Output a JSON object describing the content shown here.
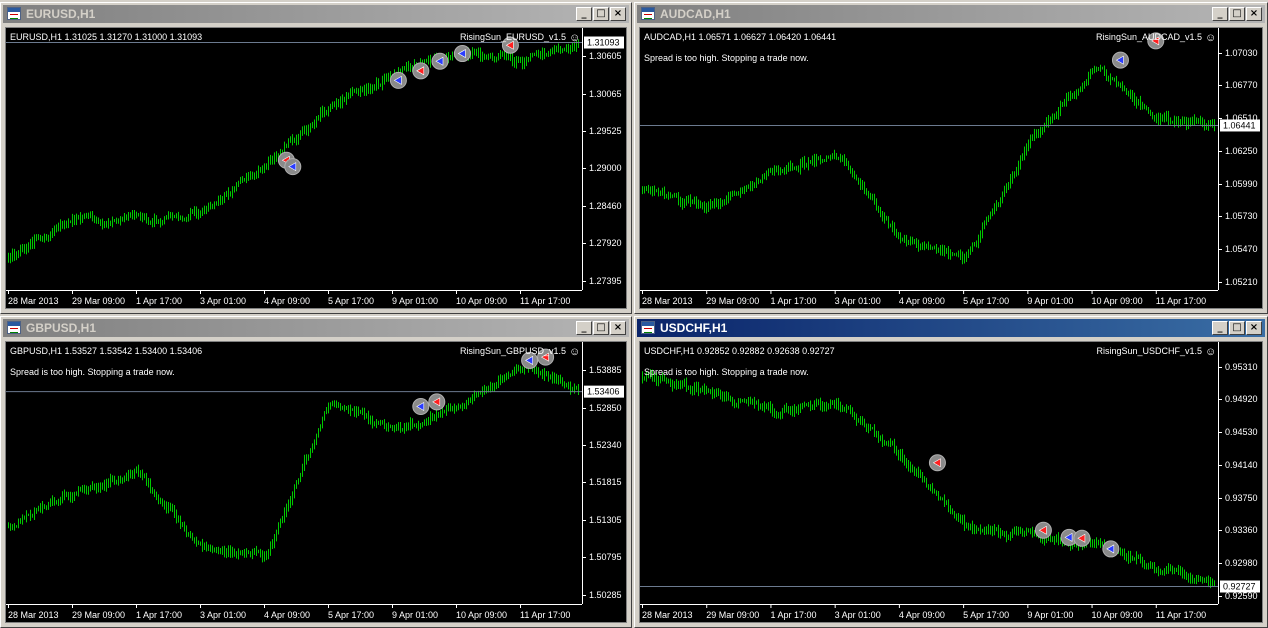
{
  "timeLabels": [
    "28 Mar 2013",
    "29 Mar 09:00",
    "1 Apr 17:00",
    "3 Apr 01:00",
    "4 Apr 09:00",
    "5 Apr 17:00",
    "9 Apr 01:00",
    "10 Apr 09:00",
    "11 Apr 17:00"
  ],
  "windowButtons": {
    "minimize": "_",
    "maximize": "□",
    "close": "×"
  },
  "colors": {
    "candle": "#00c800",
    "priceLine": "#6b7a8f",
    "axis": "#ffffff",
    "buyArrow": "#2a3cff",
    "sellArrow": "#ff2020",
    "circle": "#8a8a8a"
  },
  "windows": [
    {
      "id": "eurusd",
      "title": "EURUSD,H1",
      "active": false,
      "infoLine": "EURUSD,H1  1.31025 1.31270 1.31000 1.31093",
      "expert": "RisingSun_EURUSD_v1.5",
      "message": "",
      "currentPrice": "1.31093",
      "priceTicks": [
        "1.30605",
        "1.30065",
        "1.29525",
        "1.29000",
        "1.28460",
        "1.27920",
        "1.27395"
      ]
    },
    {
      "id": "audcad",
      "title": "AUDCAD,H1",
      "active": false,
      "infoLine": "AUDCAD,H1  1.06571 1.06627 1.06420 1.06441",
      "expert": "RisingSun_AUDCAD_v1.5",
      "message": "Spread is too high. Stopping a trade now.",
      "currentPrice": "1.06441",
      "priceTicks": [
        "1.07030",
        "1.06770",
        "1.06510",
        "1.06250",
        "1.05990",
        "1.05730",
        "1.05470",
        "1.05210"
      ]
    },
    {
      "id": "gbpusd",
      "title": "GBPUSD,H1",
      "active": false,
      "infoLine": "GBPUSD,H1  1.53527 1.53542 1.53400 1.53406",
      "expert": "RisingSun_GBPUSD_v1.5",
      "message": "Spread is too high. Stopping a trade now.",
      "currentPrice": "1.53406",
      "priceTicks": [
        "1.53885",
        "1.52850",
        "1.52340",
        "1.51815",
        "1.51305",
        "1.50795",
        "1.50285"
      ]
    },
    {
      "id": "usdchf",
      "title": "USDCHF,H1",
      "active": true,
      "infoLine": "USDCHF,H1  0.92852 0.92882 0.92638 0.92727",
      "expert": "RisingSun_USDCHF_v1.5",
      "message": "Spread is too high. Stopping a trade now.",
      "currentPrice": "0.92727",
      "priceTicks": [
        "0.95310",
        "0.94920",
        "0.94530",
        "0.94140",
        "0.93750",
        "0.93360",
        "0.92980",
        "0.92590"
      ]
    }
  ],
  "chart_data": [
    {
      "type": "line",
      "symbol": "EURUSD",
      "ylim": [
        1.2722,
        1.3132
      ],
      "x": [
        "28 Mar 2013",
        "29 Mar 09:00",
        "1 Apr 17:00",
        "3 Apr 01:00",
        "4 Apr 09:00",
        "5 Apr 17:00",
        "9 Apr 01:00",
        "10 Apr 09:00",
        "11 Apr 17:00"
      ],
      "values": [
        1.2775,
        1.2835,
        1.283,
        1.2845,
        1.292,
        1.301,
        1.306,
        1.3095,
        1.308
      ],
      "last": 1.31093,
      "trades": [
        {
          "x": 4.35,
          "price": 1.2925,
          "dir": "sell"
        },
        {
          "x": 4.45,
          "price": 1.2915,
          "dir": "buy"
        },
        {
          "x": 6.1,
          "price": 1.305,
          "dir": "buy"
        },
        {
          "x": 6.45,
          "price": 1.3065,
          "dir": "sell"
        },
        {
          "x": 6.75,
          "price": 1.308,
          "dir": "buy"
        },
        {
          "x": 7.1,
          "price": 1.3092,
          "dir": "buy"
        },
        {
          "x": 7.85,
          "price": 1.3105,
          "dir": "sell"
        }
      ]
    },
    {
      "type": "line",
      "symbol": "AUDCAD",
      "ylim": [
        1.0516,
        1.072
      ],
      "x": [
        "28 Mar 2013",
        "29 Mar 09:00",
        "1 Apr 17:00",
        "3 Apr 01:00",
        "4 Apr 09:00",
        "5 Apr 17:00",
        "9 Apr 01:00",
        "10 Apr 09:00",
        "11 Apr 17:00"
      ],
      "values": [
        1.0595,
        1.058,
        1.061,
        1.062,
        1.0555,
        1.054,
        1.063,
        1.069,
        1.065
      ],
      "last": 1.06441,
      "trades": [
        {
          "x": 7.45,
          "price": 1.0695,
          "dir": "buy"
        },
        {
          "x": 8.0,
          "price": 1.071,
          "dir": "sell"
        }
      ]
    },
    {
      "type": "line",
      "symbol": "GBPUSD",
      "ylim": [
        1.5018,
        1.5416
      ],
      "x": [
        "28 Mar 2013",
        "29 Mar 09:00",
        "1 Apr 17:00",
        "3 Apr 01:00",
        "4 Apr 09:00",
        "5 Apr 17:00",
        "9 Apr 01:00",
        "10 Apr 09:00",
        "11 Apr 17:00"
      ],
      "values": [
        1.514,
        1.5185,
        1.522,
        1.51,
        1.509,
        1.533,
        1.528,
        1.532,
        1.538
      ],
      "last": 1.53406,
      "trades": [
        {
          "x": 6.45,
          "price": 1.5318,
          "dir": "buy"
        },
        {
          "x": 6.7,
          "price": 1.5325,
          "dir": "sell"
        },
        {
          "x": 8.15,
          "price": 1.5388,
          "dir": "buy"
        },
        {
          "x": 8.4,
          "price": 1.5393,
          "dir": "sell"
        }
      ]
    },
    {
      "type": "line",
      "symbol": "USDCHF",
      "ylim": [
        0.9253,
        0.9548
      ],
      "x": [
        "28 Mar 2013",
        "29 Mar 09:00",
        "1 Apr 17:00",
        "3 Apr 01:00",
        "4 Apr 09:00",
        "5 Apr 17:00",
        "9 Apr 01:00",
        "10 Apr 09:00",
        "11 Apr 17:00"
      ],
      "values": [
        0.951,
        0.949,
        0.947,
        0.948,
        0.942,
        0.934,
        0.933,
        0.932,
        0.9295
      ],
      "last": 0.92727,
      "trades": [
        {
          "x": 4.6,
          "price": 0.9412,
          "dir": "sell"
        },
        {
          "x": 6.25,
          "price": 0.9336,
          "dir": "sell"
        },
        {
          "x": 6.65,
          "price": 0.9328,
          "dir": "buy"
        },
        {
          "x": 6.85,
          "price": 0.9327,
          "dir": "sell"
        },
        {
          "x": 7.3,
          "price": 0.9315,
          "dir": "buy"
        }
      ]
    }
  ]
}
